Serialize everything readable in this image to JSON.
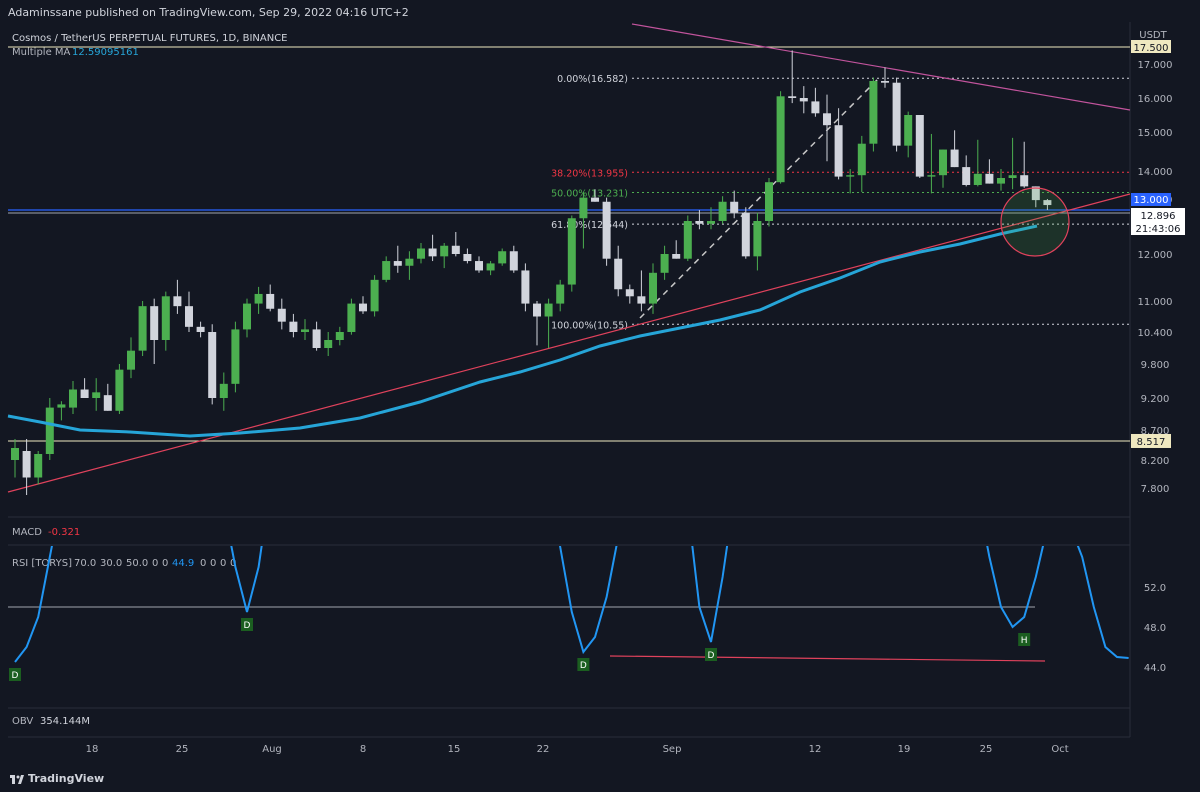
{
  "header": {
    "publisher_line": "Adaminssane published on TradingView.com, Sep 29, 2022 04:16 UTC+2"
  },
  "chart_data": [
    {
      "type": "candlestick",
      "title": "Cosmos / TetherUS PERPETUAL FUTURES, 1D, BINANCE",
      "indicator_label": "Multiple MA",
      "indicator_value": "12.59095161",
      "currency": "USDT",
      "y_ticks": [
        "17.000",
        "16.000",
        "15.000",
        "14.000",
        "13.000",
        "12.000",
        "11.000",
        "10.400",
        "9.800",
        "9.200",
        "8.700",
        "8.200",
        "7.800"
      ],
      "price_tags": {
        "top_level": "17.500",
        "current": "13.000",
        "last": "12.896",
        "countdown": "21:43:06",
        "support": "8.517"
      },
      "fib_levels": [
        {
          "label": "0.00%(16.582)",
          "value": 16.582,
          "color": "#d1d4dc"
        },
        {
          "label": "38.20%(13.955)",
          "value": 13.955,
          "color": "#f23645"
        },
        {
          "label": "50.00%(13.231)",
          "value": 13.231,
          "color": "#4caf50"
        },
        {
          "label": "61.80%(12.544)",
          "value": 12.544,
          "color": "#d1d4dc"
        },
        {
          "label": "100.00%(10.55)",
          "value": 10.55,
          "color": "#d1d4dc"
        }
      ],
      "candles": [
        [
          8.2,
          8.55,
          7.95,
          8.4
        ],
        [
          8.35,
          8.55,
          7.7,
          7.95
        ],
        [
          7.95,
          8.35,
          7.85,
          8.3
        ],
        [
          8.3,
          9.2,
          8.2,
          9.05
        ],
        [
          9.05,
          9.15,
          8.85,
          9.1
        ],
        [
          9.05,
          9.5,
          8.95,
          9.35
        ],
        [
          9.35,
          9.55,
          9.2,
          9.2
        ],
        [
          9.2,
          9.55,
          9.0,
          9.3
        ],
        [
          9.25,
          9.45,
          9.0,
          9.0
        ],
        [
          9.0,
          9.8,
          8.95,
          9.7
        ],
        [
          9.7,
          10.3,
          9.55,
          10.05
        ],
        [
          10.05,
          11.0,
          9.95,
          10.9
        ],
        [
          10.9,
          11.05,
          9.8,
          10.25
        ],
        [
          10.25,
          11.2,
          10.05,
          11.1
        ],
        [
          11.1,
          11.45,
          10.75,
          10.9
        ],
        [
          10.9,
          11.2,
          10.4,
          10.5
        ],
        [
          10.5,
          10.6,
          10.3,
          10.4
        ],
        [
          10.4,
          10.55,
          9.1,
          9.2
        ],
        [
          9.2,
          9.65,
          9.0,
          9.45
        ],
        [
          9.45,
          10.6,
          9.3,
          10.45
        ],
        [
          10.45,
          11.05,
          10.3,
          10.95
        ],
        [
          10.95,
          11.3,
          10.75,
          11.15
        ],
        [
          11.15,
          11.35,
          10.8,
          10.85
        ],
        [
          10.85,
          11.05,
          10.45,
          10.6
        ],
        [
          10.6,
          10.75,
          10.3,
          10.4
        ],
        [
          10.4,
          10.65,
          10.25,
          10.45
        ],
        [
          10.45,
          10.6,
          10.05,
          10.1
        ],
        [
          10.1,
          10.4,
          9.95,
          10.25
        ],
        [
          10.25,
          10.5,
          10.15,
          10.4
        ],
        [
          10.4,
          11.05,
          10.35,
          10.95
        ],
        [
          10.95,
          11.1,
          10.75,
          10.8
        ],
        [
          10.8,
          11.55,
          10.7,
          11.45
        ],
        [
          11.45,
          11.95,
          11.4,
          11.85
        ],
        [
          11.85,
          12.15,
          11.6,
          11.75
        ],
        [
          11.75,
          12.05,
          11.45,
          11.9
        ],
        [
          11.9,
          12.2,
          11.8,
          12.1
        ],
        [
          12.1,
          12.35,
          11.85,
          11.95
        ],
        [
          11.95,
          12.2,
          11.7,
          12.15
        ],
        [
          12.15,
          12.4,
          11.95,
          12.0
        ],
        [
          12.0,
          12.1,
          11.8,
          11.85
        ],
        [
          11.85,
          11.95,
          11.6,
          11.65
        ],
        [
          11.65,
          11.85,
          11.55,
          11.8
        ],
        [
          11.8,
          12.1,
          11.75,
          12.05
        ],
        [
          12.05,
          12.15,
          11.6,
          11.65
        ],
        [
          11.65,
          11.8,
          10.8,
          10.95
        ],
        [
          10.95,
          11.0,
          10.15,
          10.7
        ],
        [
          10.7,
          11.05,
          10.1,
          10.95
        ],
        [
          10.95,
          11.45,
          10.8,
          11.35
        ],
        [
          11.35,
          12.7,
          11.2,
          12.65
        ],
        [
          12.65,
          13.25,
          12.1,
          13.05
        ],
        [
          13.05,
          13.35,
          12.95,
          12.95
        ],
        [
          12.95,
          13.05,
          11.75,
          11.9
        ],
        [
          11.9,
          12.15,
          11.1,
          11.25
        ],
        [
          11.25,
          11.35,
          10.95,
          11.1
        ],
        [
          11.1,
          11.65,
          10.8,
          10.95
        ],
        [
          10.95,
          11.8,
          10.75,
          11.6
        ],
        [
          11.6,
          12.15,
          11.45,
          12.0
        ],
        [
          12.0,
          12.25,
          11.9,
          11.9
        ],
        [
          11.9,
          12.7,
          11.85,
          12.6
        ],
        [
          12.6,
          12.8,
          12.45,
          12.55
        ],
        [
          12.55,
          12.85,
          12.45,
          12.6
        ],
        [
          12.6,
          13.1,
          12.55,
          12.95
        ],
        [
          12.95,
          13.3,
          12.65,
          12.75
        ],
        [
          12.75,
          12.85,
          11.9,
          11.95
        ],
        [
          11.95,
          12.75,
          11.65,
          12.6
        ],
        [
          12.6,
          13.75,
          12.5,
          13.6
        ],
        [
          13.6,
          16.2,
          13.55,
          16.05
        ],
        [
          16.05,
          17.4,
          15.85,
          16.0
        ],
        [
          16.0,
          16.35,
          15.55,
          15.9
        ],
        [
          15.9,
          16.3,
          15.45,
          15.55
        ],
        [
          15.55,
          16.1,
          14.25,
          15.2
        ],
        [
          15.2,
          15.7,
          13.7,
          13.8
        ],
        [
          13.8,
          14.05,
          13.2,
          13.85
        ],
        [
          13.85,
          14.9,
          13.25,
          14.7
        ],
        [
          14.7,
          16.6,
          14.5,
          16.5
        ],
        [
          16.5,
          16.9,
          16.3,
          16.45
        ],
        [
          16.45,
          16.6,
          14.5,
          14.65
        ],
        [
          14.65,
          15.6,
          14.35,
          15.5
        ],
        [
          15.5,
          15.5,
          13.75,
          13.8
        ],
        [
          13.8,
          14.95,
          13.2,
          13.85
        ],
        [
          13.85,
          14.55,
          13.4,
          14.55
        ],
        [
          14.55,
          15.05,
          14.1,
          14.1
        ],
        [
          14.1,
          14.4,
          13.45,
          13.5
        ],
        [
          13.5,
          14.8,
          13.45,
          13.9
        ],
        [
          13.9,
          14.3,
          13.55,
          13.55
        ],
        [
          13.55,
          14.05,
          13.3,
          13.75
        ],
        [
          13.75,
          14.85,
          13.35,
          13.85
        ],
        [
          13.85,
          14.75,
          13.4,
          13.45
        ],
        [
          13.45,
          13.45,
          12.85,
          12.98
        ],
        [
          12.98,
          13.0,
          12.8,
          12.89
        ]
      ],
      "x_ticks": [
        "18",
        "25",
        "Aug",
        "8",
        "15",
        "22",
        "Sep",
        "12",
        "19",
        "25",
        "Oct"
      ]
    },
    {
      "type": "indicator",
      "name": "MACD",
      "value": "-0.321"
    },
    {
      "type": "line",
      "name": "RSI [TORYS]",
      "params": [
        "70.0",
        "30.0",
        "50.0",
        "0",
        "0",
        "0",
        "0",
        "0",
        "0"
      ],
      "value": "44.9",
      "y_ticks": [
        "52.0",
        "48.0",
        "44.0"
      ],
      "level_line": 50,
      "values": [
        44.5,
        46,
        49,
        55,
        61,
        67,
        72,
        76,
        80,
        84,
        86,
        88,
        89,
        84,
        80,
        76,
        71,
        66,
        60,
        54,
        49.5,
        54,
        62,
        70,
        77,
        82,
        84,
        85,
        84,
        82,
        80,
        76,
        72,
        66,
        62,
        59,
        62,
        66,
        71,
        74,
        76,
        77,
        78,
        75,
        73,
        69,
        63,
        56,
        49.5,
        45.5,
        47,
        51,
        57,
        66,
        72,
        76,
        74,
        70,
        60,
        50,
        46.5,
        53,
        61,
        68,
        73,
        78,
        81,
        85,
        82,
        78,
        71,
        64,
        61,
        59,
        62,
        66,
        70,
        73,
        75,
        75,
        73,
        70,
        66,
        61,
        55,
        50,
        48,
        49,
        53,
        58,
        62,
        58,
        55,
        50,
        46,
        45,
        44.9
      ],
      "markers": [
        {
          "label": "D",
          "i": 0,
          "v": 44.5
        },
        {
          "label": "D",
          "i": 20,
          "v": 49.5
        },
        {
          "label": "D",
          "i": 49,
          "v": 45.5
        },
        {
          "label": "D",
          "i": 60,
          "v": 46.5
        },
        {
          "label": "H",
          "i": 87,
          "v": 48.0
        }
      ]
    },
    {
      "type": "indicator",
      "name": "OBV",
      "value": "354.144M"
    }
  ],
  "colors": {
    "background": "#131722",
    "up": "#4caf50",
    "down": "#d1d4dc",
    "ma": "#26a5d8",
    "trend_support": "#e0425c",
    "trend_resistance": "#c2549d",
    "level_blue": "#2962ff",
    "rsi": "#2196f3"
  },
  "branding": {
    "logo_text": "TradingView"
  }
}
